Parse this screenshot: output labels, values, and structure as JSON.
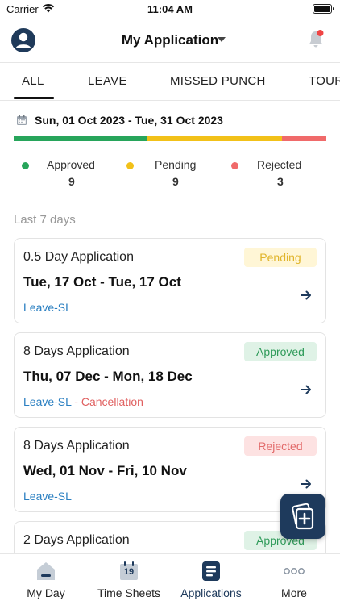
{
  "status_bar": {
    "carrier": "Carrier",
    "time": "11:04 AM"
  },
  "header": {
    "title": "My Application"
  },
  "tabs": [
    {
      "label": "ALL",
      "active": true
    },
    {
      "label": "LEAVE",
      "active": false
    },
    {
      "label": "MISSED PUNCH",
      "active": false
    },
    {
      "label": "TOUR",
      "active": false
    }
  ],
  "summary": {
    "date_range": "Sun, 01 Oct 2023 - Tue, 31 Oct 2023",
    "approved": {
      "label": "Approved",
      "count": "9",
      "color": "#27a55b"
    },
    "pending": {
      "label": "Pending",
      "count": "9",
      "color": "#f2c119"
    },
    "rejected": {
      "label": "Rejected",
      "count": "3",
      "color": "#f06a6a"
    }
  },
  "section_title": "Last 7 days",
  "applications": [
    {
      "title": "0.5 Day Application",
      "dates": "Tue, 17 Oct - Tue, 17 Oct",
      "type": "Leave-SL",
      "extra": "",
      "status": "Pending",
      "status_key": "pending"
    },
    {
      "title": "8 Days Application",
      "dates": "Thu, 07 Dec - Mon, 18 Dec",
      "type": "Leave-SL",
      "extra": " - Cancellation",
      "status": "Approved",
      "status_key": "approved"
    },
    {
      "title": "8 Days Application",
      "dates": "Wed, 01 Nov - Fri, 10 Nov",
      "type": "Leave-SL",
      "extra": "",
      "status": "Rejected",
      "status_key": "rejected"
    },
    {
      "title": "2 Days Application",
      "dates": "",
      "type": "",
      "extra": "",
      "status": "Approved",
      "status_key": "approved"
    }
  ],
  "bottom_nav": [
    {
      "label": "My Day",
      "icon": "home-icon",
      "active": false
    },
    {
      "label": "Time Sheets",
      "icon": "calendar-icon",
      "calendar_day": "19",
      "active": false
    },
    {
      "label": "Applications",
      "icon": "document-list-icon",
      "active": true
    },
    {
      "label": "More",
      "icon": "more-dots-icon",
      "active": false
    }
  ],
  "colors": {
    "accent": "#1e3a5c",
    "link": "#2a7fc1",
    "cancel": "#e06060"
  }
}
